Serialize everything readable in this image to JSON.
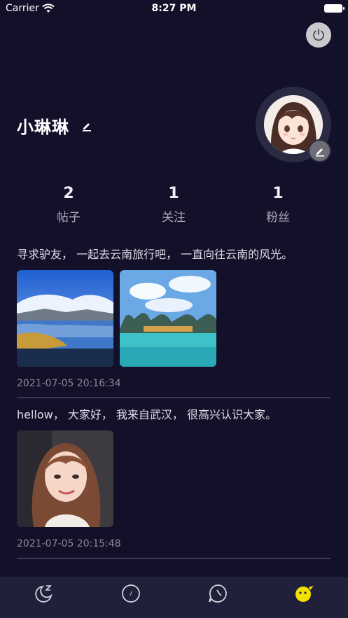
{
  "status_bar": {
    "carrier": "Carrier",
    "time": "8:27 PM"
  },
  "profile": {
    "username": "小琳琳",
    "stats": [
      {
        "value": "2",
        "label": "帖子"
      },
      {
        "value": "1",
        "label": "关注"
      },
      {
        "value": "1",
        "label": "粉丝"
      }
    ]
  },
  "posts": [
    {
      "text": "寻求驴友， 一起去云南旅行吧， 一直向往云南的风光。",
      "time": "2021-07-05 20:16:34",
      "photos": [
        "lake-landscape-photo",
        "karst-lake-photo"
      ]
    },
    {
      "text": "hellow， 大家好， 我来自武汉， 很高兴认识大家。",
      "time": "2021-07-05 20:15:48",
      "photos": [
        "selfie-photo"
      ]
    }
  ],
  "tab_bar": {
    "items": [
      "sleep-moon-icon",
      "compass-icon",
      "chat-bubble-icon",
      "smiley-icon"
    ],
    "active_index": 3,
    "active_color": "#f4e000"
  },
  "colors": {
    "background": "#13102a",
    "tab_bar": "#21203a",
    "text_muted": "#8b8a99"
  }
}
